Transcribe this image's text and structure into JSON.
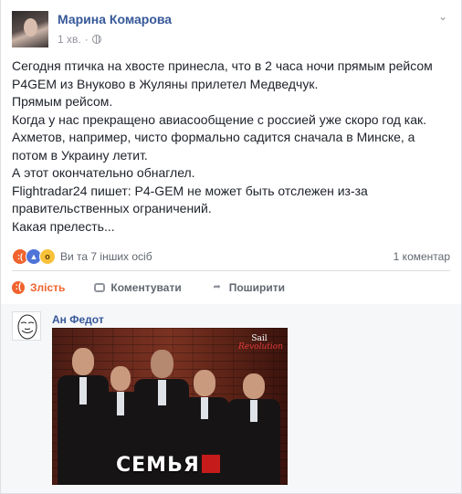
{
  "post": {
    "author": "Марина Комарова",
    "time": "1 хв.",
    "separator": "·",
    "paragraphs": [
      "Сегодня птичка на хвосте принесла, что в 2 часа ночи прямым рейсом P4GEM из Внуково в Жуляны прилетел Медведчук.",
      "Прямым рейсом.",
      "Когда у нас прекращено авиасообщение с россией уже скоро год как.",
      "Ахметов, например, чисто формально садится сначала в Минске, а потом в Украину летит.",
      "А этот окончательно обнаглел.",
      "Flightradar24 пишет: P4-GEM не может быть отслежен из-за правительственных ограничений.",
      "Какая прелесть..."
    ]
  },
  "reactions": {
    "icons": [
      "angry-reaction",
      "like-reaction",
      "wow-reaction"
    ],
    "summary": "Ви та 7 інших осіб",
    "comments_count": "1 коментар"
  },
  "actions": {
    "react_label": "Злість",
    "comment_label": "Коментувати",
    "share_label": "Поширити"
  },
  "comment": {
    "author": "Ан Федот",
    "image_title": "СЕМЬЯ",
    "image_logo_top": "Sail",
    "image_logo_bottom": "Revolution"
  },
  "colors": {
    "link_blue": "#365899",
    "angry_orange": "#f0632e",
    "like_blue": "#4e74d8",
    "wow_yellow": "#f7c13a"
  }
}
